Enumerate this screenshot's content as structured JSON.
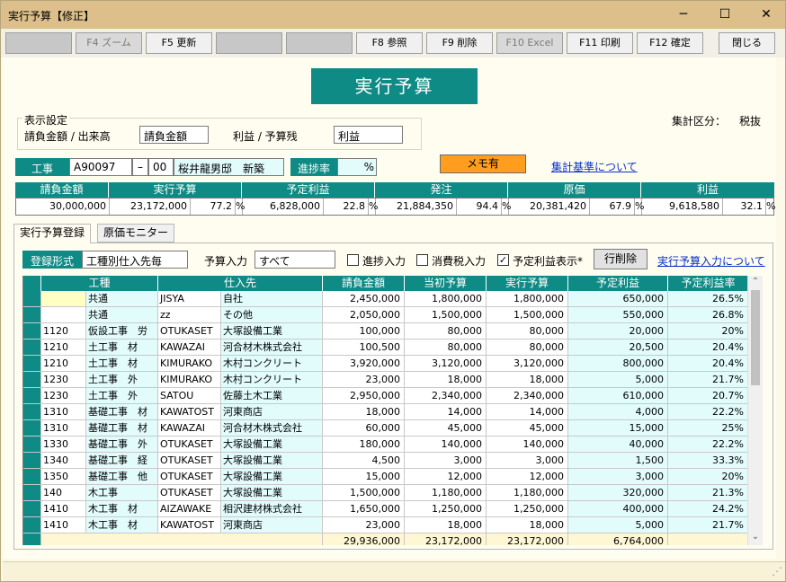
{
  "window": {
    "title": "実行予算【修正】",
    "minimize": "─",
    "maximize": "☐",
    "close": "✕"
  },
  "toolbar": {
    "buttons": [
      "",
      "F4 ズーム",
      "F5 更新",
      "",
      "",
      "F8 参照",
      "F9 削除",
      "F10 Excel",
      "F11 印刷",
      "F12 確定"
    ],
    "close": "閉じる"
  },
  "page_title": "実行予算",
  "display": {
    "legend": "表示設定",
    "amount_label": "請負金額 / 出来高",
    "amount_value": "請負金額",
    "profit_label": "利益 / 予算残",
    "profit_value": "利益",
    "tax_label": "集計区分：",
    "tax_value": "税抜"
  },
  "job": {
    "label": "工事",
    "code": "A90097",
    "dash": "–",
    "sub": "00",
    "name": "桜井龍男邸　新築",
    "progress_label": "進捗率",
    "progress_unit": "%"
  },
  "memo": "メモ有",
  "basis_link": "集計基準について",
  "summary": {
    "headers": [
      "請負金額",
      "実行予算",
      "予定利益",
      "発注",
      "原価",
      "利益"
    ],
    "contract": "30,000,000",
    "budget": "23,172,000",
    "budget_pct": "77.2",
    "planned": "6,828,000",
    "planned_pct": "22.8",
    "order": "21,884,350",
    "order_pct": "94.4",
    "cost": "20,381,420",
    "cost_pct": "67.9",
    "profit": "9,618,580",
    "profit_pct": "32.1",
    "pct": "%"
  },
  "tabs": [
    "実行予算登録",
    "原価モニター"
  ],
  "form": {
    "reg_label": "登録形式",
    "reg_value": "工種別仕入先毎",
    "input_label": "予算入力",
    "input_value": "すべて",
    "chk1": "進捗入力",
    "chk2": "消費税入力",
    "chk3": "予定利益表示*",
    "check_mark": "✓",
    "delete_btn": "行削除",
    "help_link": "実行予算入力について"
  },
  "grid": {
    "headers": [
      "工種",
      "仕入先",
      "請負金額",
      "当初予算",
      "実行予算",
      "予定利益",
      "予定利益率"
    ],
    "rows": [
      [
        "",
        "共通",
        "JISYA",
        "自社",
        "2,450,000",
        "1,800,000",
        "1,800,000",
        "650,000",
        "26.5%"
      ],
      [
        "",
        "共通",
        "zz",
        "その他",
        "2,050,000",
        "1,500,000",
        "1,500,000",
        "550,000",
        "26.8%"
      ],
      [
        "1120",
        "仮設工事　労",
        "OTUKASET",
        "大塚設備工業",
        "100,000",
        "80,000",
        "80,000",
        "20,000",
        "20%"
      ],
      [
        "1210",
        "土工事　材",
        "KAWAZAI",
        "河合材木株式会社",
        "100,500",
        "80,000",
        "80,000",
        "20,500",
        "20.4%"
      ],
      [
        "1210",
        "土工事　材",
        "KIMURAKO",
        "木村コンクリート",
        "3,920,000",
        "3,120,000",
        "3,120,000",
        "800,000",
        "20.4%"
      ],
      [
        "1230",
        "土工事　外",
        "KIMURAKO",
        "木村コンクリート",
        "23,000",
        "18,000",
        "18,000",
        "5,000",
        "21.7%"
      ],
      [
        "1230",
        "土工事　外",
        "SATOU",
        "佐藤土木工業",
        "2,950,000",
        "2,340,000",
        "2,340,000",
        "610,000",
        "20.7%"
      ],
      [
        "1310",
        "基礎工事　材",
        "KAWATOST",
        "河東商店",
        "18,000",
        "14,000",
        "14,000",
        "4,000",
        "22.2%"
      ],
      [
        "1310",
        "基礎工事　材",
        "KAWAZAI",
        "河合材木株式会社",
        "60,000",
        "45,000",
        "45,000",
        "15,000",
        "25%"
      ],
      [
        "1330",
        "基礎工事　外",
        "OTUKASET",
        "大塚設備工業",
        "180,000",
        "140,000",
        "140,000",
        "40,000",
        "22.2%"
      ],
      [
        "1340",
        "基礎工事　経",
        "OTUKASET",
        "大塚設備工業",
        "4,500",
        "3,000",
        "3,000",
        "1,500",
        "33.3%"
      ],
      [
        "1350",
        "基礎工事　他",
        "OTUKASET",
        "大塚設備工業",
        "15,000",
        "12,000",
        "12,000",
        "3,000",
        "20%"
      ],
      [
        "140",
        "木工事",
        "OTUKASET",
        "大塚設備工業",
        "1,500,000",
        "1,180,000",
        "1,180,000",
        "320,000",
        "21.3%"
      ],
      [
        "1410",
        "木工事　材",
        "AIZAWAKE",
        "相沢建材株式会社",
        "1,650,000",
        "1,250,000",
        "1,250,000",
        "400,000",
        "24.2%"
      ],
      [
        "1410",
        "木工事　材",
        "KAWATOST",
        "河東商店",
        "23,000",
        "18,000",
        "18,000",
        "5,000",
        "21.7%"
      ]
    ],
    "totals": [
      "29,936,000",
      "23,172,000",
      "23,172,000",
      "6,764,000"
    ]
  },
  "scroll": {
    "up": "⌃",
    "down": "⌄"
  },
  "grip": "⋰"
}
